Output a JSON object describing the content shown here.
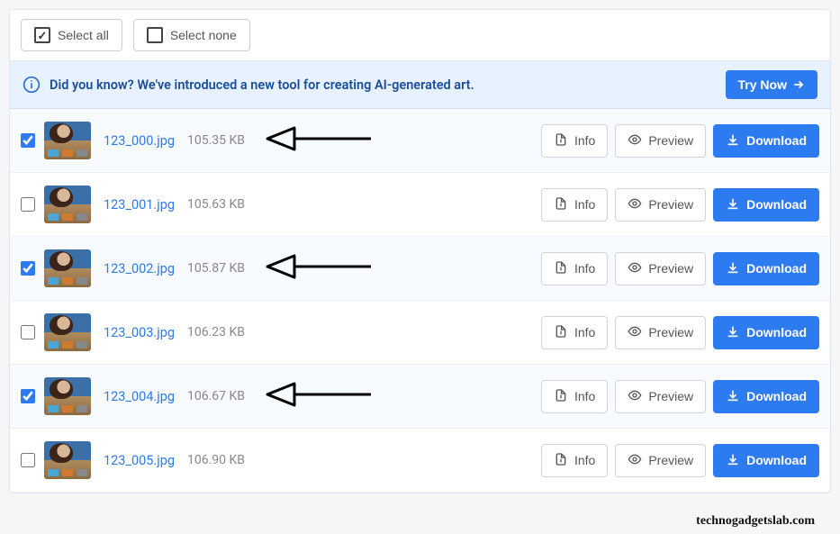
{
  "toolbar": {
    "select_all": "Select all",
    "select_none": "Select none"
  },
  "banner": {
    "text": "Did you know? We've introduced a new tool for creating AI-generated art.",
    "cta": "Try Now"
  },
  "buttons": {
    "info": "Info",
    "preview": "Preview",
    "download": "Download"
  },
  "files": [
    {
      "name": "123_000.jpg",
      "size": "105.35 KB",
      "checked": true,
      "arrow": true
    },
    {
      "name": "123_001.jpg",
      "size": "105.63 KB",
      "checked": false,
      "arrow": false
    },
    {
      "name": "123_002.jpg",
      "size": "105.87 KB",
      "checked": true,
      "arrow": true
    },
    {
      "name": "123_003.jpg",
      "size": "106.23 KB",
      "checked": false,
      "arrow": false
    },
    {
      "name": "123_004.jpg",
      "size": "106.67 KB",
      "checked": true,
      "arrow": true
    },
    {
      "name": "123_005.jpg",
      "size": "106.90 KB",
      "checked": false,
      "arrow": false
    }
  ],
  "watermark": "technogadgetslab.com"
}
